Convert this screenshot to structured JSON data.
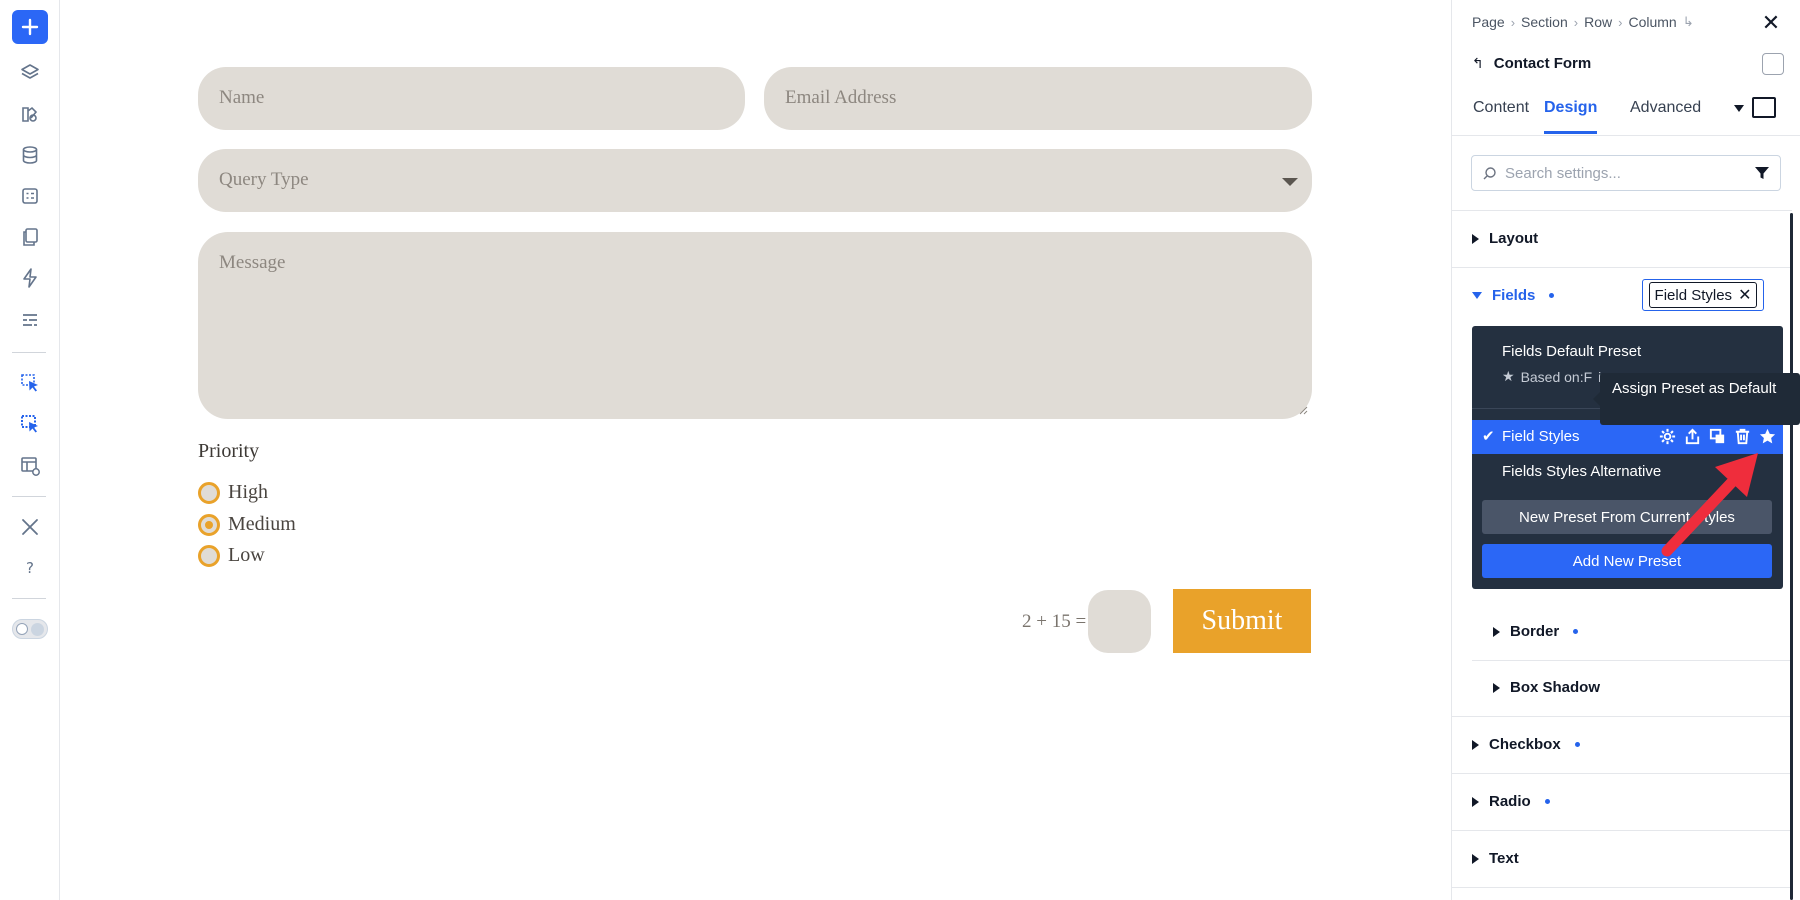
{
  "canvas": {
    "form": {
      "name_placeholder": "Name",
      "email_placeholder": "Email Address",
      "query_placeholder": "Query Type",
      "message_placeholder": "Message",
      "priority_label": "Priority",
      "priority_options": [
        "High",
        "Medium",
        "Low"
      ],
      "selected_priority": "Medium",
      "captcha_question": "2 + 15 =",
      "submit_label": "Submit"
    },
    "colors": {
      "field_bg": "#e0dcd6",
      "accent": "#e9a22a"
    }
  },
  "panel": {
    "breadcrumb": [
      "Page",
      "Section",
      "Row",
      "Column"
    ],
    "module_title": "Contact Form",
    "tabs": [
      "Content",
      "Design",
      "Advanced"
    ],
    "active_tab": "Design",
    "search_placeholder": "Search settings...",
    "sections": {
      "layout": "Layout",
      "fields": "Fields",
      "border": "Border",
      "box_shadow": "Box Shadow",
      "checkbox": "Checkbox",
      "radio": "Radio",
      "text": "Text"
    },
    "preset_chip": "Field Styles",
    "preset_menu": {
      "default_title": "Fields Default Preset",
      "based_on": "Based on:F",
      "based_on_suffix": "i",
      "active_preset": "Field Styles",
      "alternative_preset": "Fields Styles Alternative",
      "new_from_current": "New Preset From Current Styles",
      "add_new": "Add New Preset"
    },
    "tooltip": "Assign Preset as Default",
    "colors": {
      "primary": "#2b67f6",
      "menu_bg": "#243040"
    }
  }
}
